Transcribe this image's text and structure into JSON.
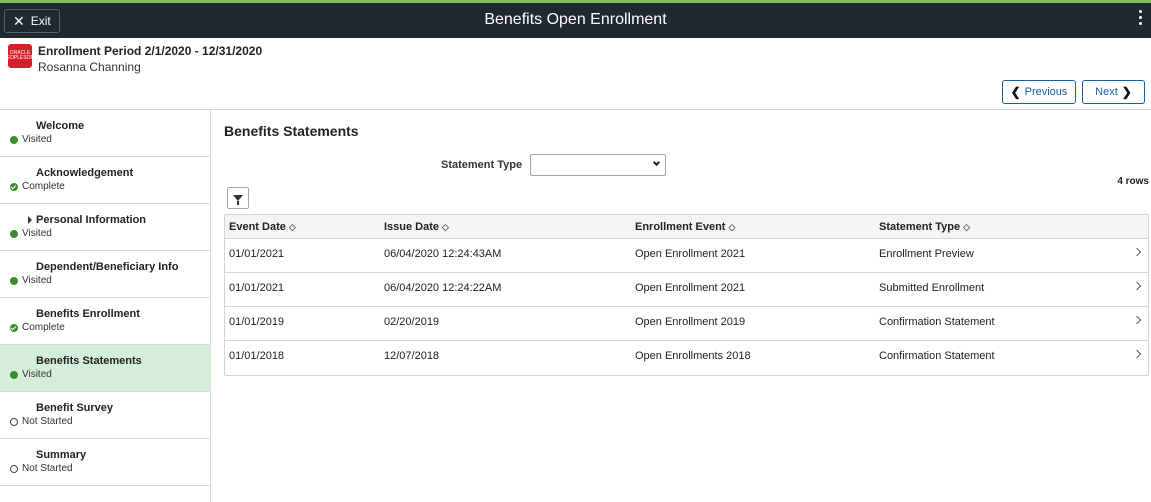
{
  "topbar": {
    "exit_label": "Exit",
    "title": "Benefits Open Enrollment"
  },
  "header": {
    "logo_line1": "ORACLE",
    "logo_line2": "PEOPLESOFT",
    "period": "Enrollment Period 2/1/2020 - 12/31/2020",
    "person": "Rosanna Channing",
    "previous_label": "Previous",
    "next_label": "Next"
  },
  "sidebar": {
    "items": [
      {
        "label": "Welcome",
        "status": "Visited"
      },
      {
        "label": "Acknowledgement",
        "status": "Complete"
      },
      {
        "label": "Personal Information",
        "status": "Visited"
      },
      {
        "label": "Dependent/Beneficiary Info",
        "status": "Visited"
      },
      {
        "label": "Benefits Enrollment",
        "status": "Complete"
      },
      {
        "label": "Benefits Statements",
        "status": "Visited"
      },
      {
        "label": "Benefit Survey",
        "status": "Not Started"
      },
      {
        "label": "Summary",
        "status": "Not Started"
      }
    ]
  },
  "main": {
    "heading": "Benefits Statements",
    "filter_label": "Statement Type",
    "filter_value": "",
    "rows_count": "4 rows",
    "columns": [
      "Event Date",
      "Issue Date",
      "Enrollment Event",
      "Statement Type"
    ],
    "rows": [
      [
        "01/01/2021",
        "06/04/2020 12:24:43AM",
        "Open Enrollment 2021",
        "Enrollment Preview"
      ],
      [
        "01/01/2021",
        "06/04/2020 12:24:22AM",
        "Open Enrollment 2021",
        "Submitted Enrollment"
      ],
      [
        "01/01/2019",
        "02/20/2019",
        "Open Enrollment 2019",
        "Confirmation Statement"
      ],
      [
        "01/01/2018",
        "12/07/2018",
        "Open Enrollments 2018",
        "Confirmation Statement"
      ]
    ]
  },
  "colors": {
    "topbar": "#1f2a30",
    "accent": "#1a5fa0",
    "active_step": "#d5eedb",
    "status_green": "#3c8c2d"
  }
}
